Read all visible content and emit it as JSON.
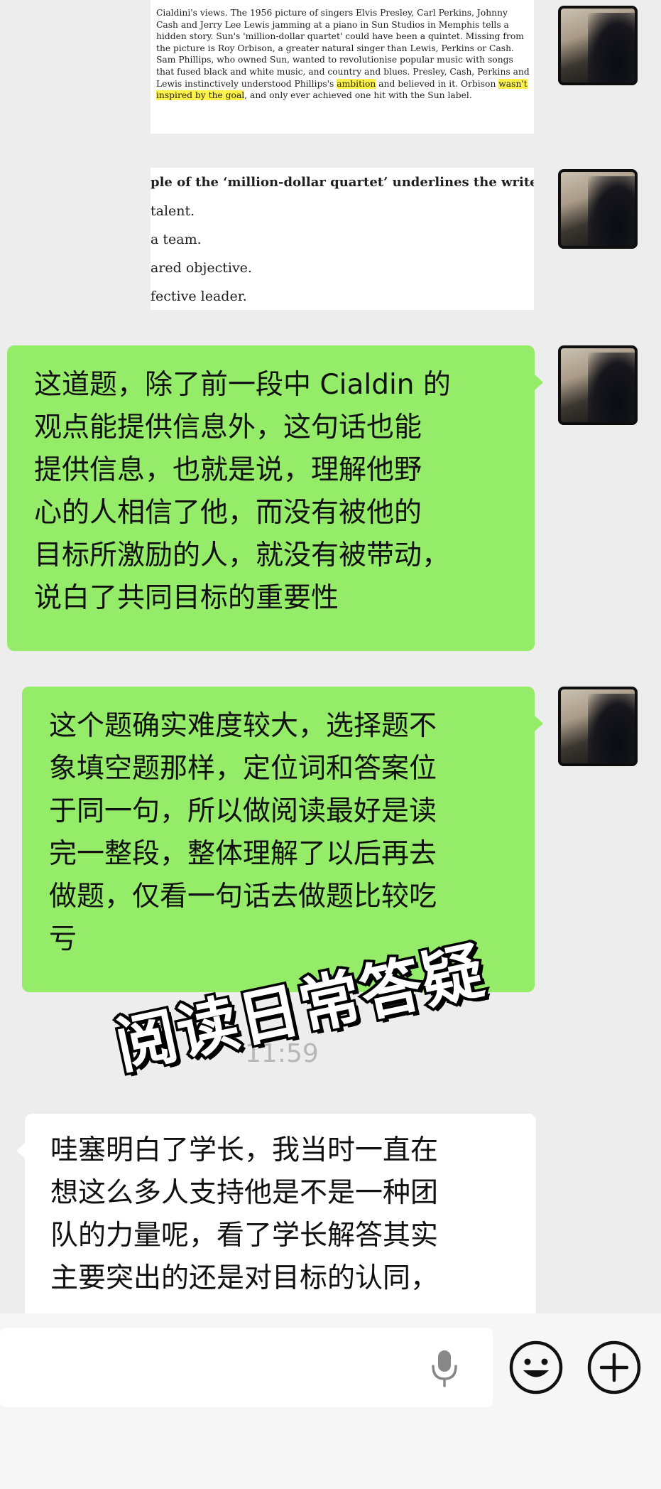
{
  "image_message_1": {
    "lines": [
      "Cialdini's views. The 1956 picture of singers Elvis Presley, Carl Perkins, Johnny",
      "Cash and Jerry Lee Lewis jamming at a piano in Sun Studios in Memphis tells a",
      "hidden story. Sun's 'million-dollar quartet' could have been a quintet. Missing from",
      "the picture is Roy Orbison, a greater natural singer than Lewis, Perkins or Cash.",
      "Sam Phillips, who owned Sun, wanted to revolutionise popular music with songs",
      "that fused black and white music, and country and blues. Presley, Cash, Perkins and"
    ],
    "line7_before": "Lewis instinctively understood Phillips's ",
    "line7_hl1": "ambition",
    "line7_mid": " and believed in it. Orbison ",
    "line7_hl2": "wasn't",
    "line8_hl": "inspired by the goal",
    "line8_after": ", and only ever achieved one hit with the Sun label."
  },
  "image_message_2": {
    "stem": "ple of the ‘million-dollar quartet’ underlines the writer",
    "options": [
      "talent.",
      "a team.",
      "ared objective.",
      "fective leader."
    ]
  },
  "messages": {
    "msg1_lines": [
      "这道题，除了前一段中 Cialdin 的",
      "观点能提供信息外，这句话也能",
      "提供信息，也就是说，理解他野",
      "心的人相信了他，而没有被他的",
      "目标所激励的人，就没有被带动，",
      "说白了共同目标的重要性"
    ],
    "msg2_lines": [
      "这个题确实难度较大，选择题不",
      "象填空题那样，定位词和答案位",
      "于同一句，所以做阅读最好是读",
      "完一整段，整体理解了以后再去",
      "做题，仅看一句话去做题比较吃",
      "亏"
    ],
    "msg3_lines": [
      "哇塞明白了学长，我当时一直在",
      "想这么多人支持他是不是一种团",
      "队的力量呢，看了学长解答其实",
      "主要突出的还是对目标的认同，"
    ]
  },
  "timestamp": "11:59",
  "overlay_title": "阅读日常答疑",
  "input_bar": {
    "mic_icon": "microphone-icon",
    "emoji_icon": "smiley-icon",
    "plus_icon": "plus-icon"
  },
  "colors": {
    "chat_background": "#ededed",
    "sent_bubble": "#95ec69",
    "received_bubble": "#ffffff",
    "highlight": "#fff34a"
  }
}
